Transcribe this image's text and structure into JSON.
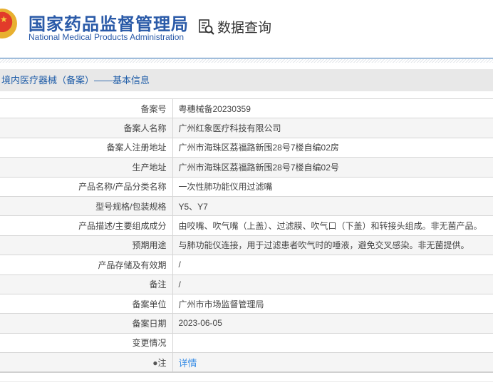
{
  "header": {
    "title_cn": "国家药品监督管理局",
    "title_en": "National Medical Products Administration",
    "query_label": "数据查询"
  },
  "section_title": "境内医疗器械（备案）——基本信息",
  "rows": [
    {
      "label": "备案号",
      "value": "粤穗械备20230359"
    },
    {
      "label": "备案人名称",
      "value": "广州红象医疗科技有限公司"
    },
    {
      "label": "备案人注册地址",
      "value": "广州市海珠区荔福路新围28号7楼自编02房"
    },
    {
      "label": "生产地址",
      "value": "广州市海珠区荔福路新围28号7楼自编02号"
    },
    {
      "label": "产品名称/产品分类名称",
      "value": "一次性肺功能仪用过滤嘴"
    },
    {
      "label": "型号规格/包装规格",
      "value": "Y5、Y7"
    },
    {
      "label": "产品描述/主要组成成分",
      "value": "由咬嘴、吹气嘴（上盖）、过滤膜、吹气口（下盖）和转接头组成。非无菌产品。"
    },
    {
      "label": "预期用途",
      "value": "与肺功能仪连接，用于过滤患者吹气时的唾液，避免交叉感染。非无菌提供。"
    },
    {
      "label": "产品存储及有效期",
      "value": "/"
    },
    {
      "label": "备注",
      "value": "/"
    },
    {
      "label": "备案单位",
      "value": "广州市市场监督管理局"
    },
    {
      "label": "备案日期",
      "value": "2023-06-05"
    },
    {
      "label": "变更情况",
      "value": ""
    },
    {
      "label": "注",
      "value": "详情"
    }
  ]
}
